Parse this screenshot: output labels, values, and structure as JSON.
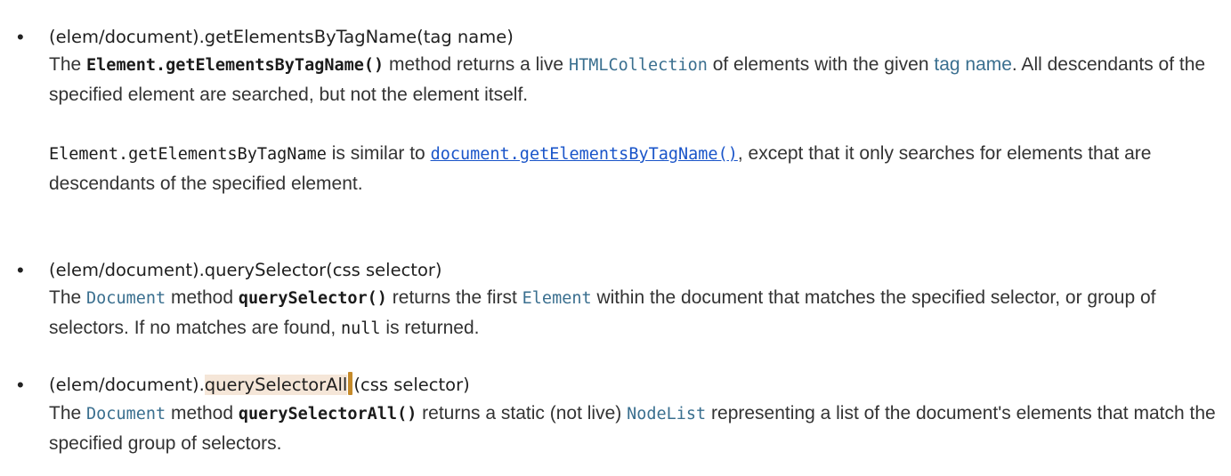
{
  "items": [
    {
      "heading": "(elem/document).getElementsByTagName(tag name)",
      "p1": {
        "t1": "The ",
        "c1": "Element.getElementsByTagName()",
        "t2": " method returns a live ",
        "l1": "HTMLCollection",
        "t3": " of elements with the given ",
        "l2": "tag name",
        "t4": ". All descendants of the specified element are searched, but not the element itself."
      },
      "p2": {
        "c1": "Element.getElementsByTagName",
        "t1": " is similar to ",
        "l1": "document.getElementsByTagName()",
        "t2": ", except that it only searches for elements that are descendants of the specified element."
      }
    },
    {
      "heading": "(elem/document).querySelector(css selector)",
      "p1": {
        "t1": "The ",
        "l1": "Document",
        "t2": " method ",
        "c1": "querySelector()",
        "t3": " returns the first ",
        "l2": "Element",
        "t4": " within the document that matches the specified selector, or group of selectors. If no matches are found, ",
        "c2": "null",
        "t5": " is returned."
      }
    },
    {
      "heading_pre": "(elem/document).",
      "heading_hl": "querySelectorAll",
      "heading_post": "(css selector)",
      "p1": {
        "t1": "The ",
        "l1": "Document",
        "t2": " method ",
        "c1": "querySelectorAll()",
        "t3": " returns a static (not live) ",
        "l2": "NodeList",
        "t4": " representing a list of the document's elements that match the specified group of selectors."
      }
    }
  ],
  "bullet": "•"
}
